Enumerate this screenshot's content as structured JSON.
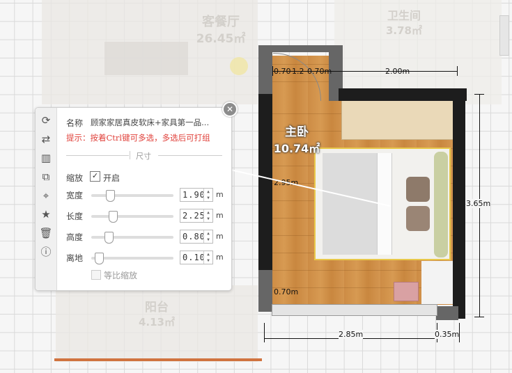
{
  "rooms": {
    "living": {
      "name": "客餐厅",
      "area": "26.45㎡"
    },
    "bath": {
      "name": "卫生间",
      "area": "3.78㎡"
    },
    "master": {
      "name": "主卧",
      "area": "10.74㎡"
    },
    "balcony": {
      "name": "阳台",
      "area": "4.13㎡"
    }
  },
  "dimensions": {
    "door_left": "0.70",
    "door_right": "0.70m",
    "door_mid": "1.2",
    "top_wall": "2.00m",
    "right_height": "3.65m",
    "room_height": "2.95m",
    "bottom_left": "0.70m",
    "bottom_width": "2.85m",
    "bottom_right": "0.35m"
  },
  "panel": {
    "tools": [
      {
        "name": "rotate-icon",
        "glyph": "⟳"
      },
      {
        "name": "swap-icon",
        "glyph": "⇄"
      },
      {
        "name": "align-icon",
        "glyph": "▥"
      },
      {
        "name": "copy-icon",
        "glyph": "⧉"
      },
      {
        "name": "position-icon",
        "glyph": "⌖"
      },
      {
        "name": "favorite-icon",
        "glyph": "★"
      },
      {
        "name": "delete-icon",
        "glyph": "🗑"
      },
      {
        "name": "info-icon",
        "glyph": "ⓘ"
      }
    ],
    "name_label": "名称",
    "name_value": "顾家家居真皮软床+家具第一品...",
    "hint": "提示：按着Ctrl键可多选，多选后可打组",
    "section_title": "尺寸",
    "scale_label": "缩放",
    "scale_toggle_label": "开启",
    "scale_enabled": true,
    "fields": [
      {
        "label": "宽度",
        "value": "1.90",
        "unit": "m",
        "level": 0.2
      },
      {
        "label": "长度",
        "value": "2.25",
        "unit": "m",
        "level": 0.23
      },
      {
        "label": "高度",
        "value": "0.80",
        "unit": "m",
        "level": 0.18
      },
      {
        "label": "离地",
        "value": "0.10",
        "unit": "m",
        "level": 0.05
      }
    ],
    "proportional_label": "等比缩放",
    "proportional_enabled": false
  },
  "colors": {
    "accent_hint": "#e0403a",
    "selection": "#e8c84a",
    "scrollbar": "#d0733f"
  }
}
